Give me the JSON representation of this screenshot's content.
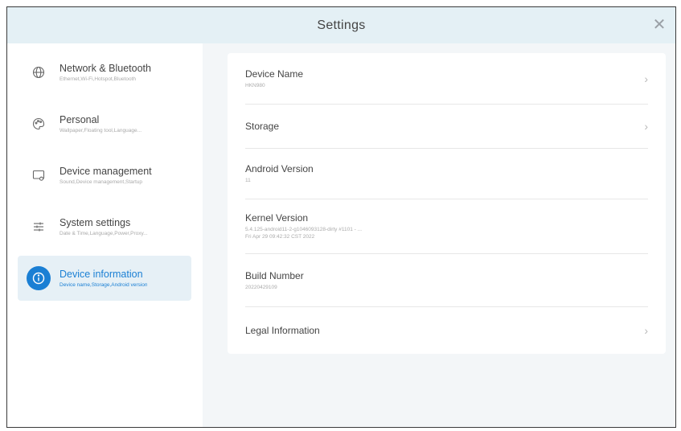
{
  "window": {
    "title": "Settings"
  },
  "sidebar": {
    "items": [
      {
        "label": "Network & Bluetooth",
        "sub": "Ethernet,Wi-Fi,Hotspot,Bluetooth",
        "icon": "globe-icon"
      },
      {
        "label": "Personal",
        "sub": "Wallpaper,Floating tool,Language...",
        "icon": "palette-icon"
      },
      {
        "label": "Device management",
        "sub": "Sound,Device management,Startup",
        "icon": "device-icon"
      },
      {
        "label": "System settings",
        "sub": "Date & Time,Language,Power,Proxy...",
        "icon": "sliders-icon"
      },
      {
        "label": "Device information",
        "sub": "Device name,Storage,Android version",
        "icon": "info-icon"
      }
    ],
    "active_index": 4
  },
  "details": {
    "rows": [
      {
        "label": "Device Name",
        "value": "HKN980",
        "chevron": true
      },
      {
        "label": "Storage",
        "value": "",
        "chevron": true
      },
      {
        "label": "Android Version",
        "value": "11",
        "chevron": false
      },
      {
        "label": "Kernel Version",
        "value": "5.4.125-android11-2-g1046093128-dirty #1101 - ...",
        "value2": "Fri Apr 29 09:42:32 CST 2022",
        "chevron": false
      },
      {
        "label": "Build Number",
        "value": "20220429109",
        "chevron": false
      },
      {
        "label": "Legal Information",
        "value": "",
        "chevron": true
      }
    ]
  },
  "colors": {
    "accent": "#1a7fd4",
    "titlebar": "#e4f0f5"
  }
}
